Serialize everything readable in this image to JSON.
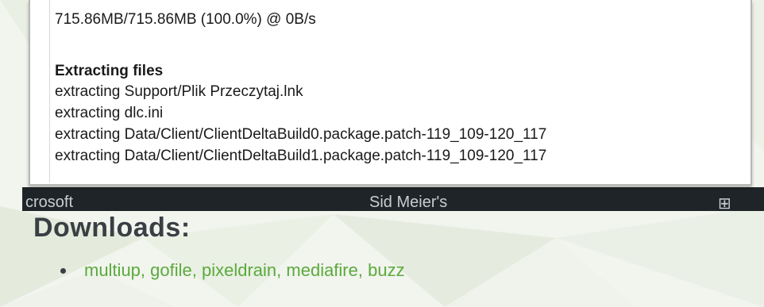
{
  "log": {
    "progress": "715.86MB/715.86MB (100.0%) @ 0B/s",
    "heading": "Extracting files",
    "lines": [
      "extracting Support/Plik Przeczytaj.lnk",
      "extracting dlc.ini",
      "extracting Data/Client/ClientDeltaBuild0.package.patch-119_109-120_117",
      "extracting Data/Client/ClientDeltaBuild1.package.patch-119_109-120_117"
    ]
  },
  "background_strip": {
    "left_text": "crosoft",
    "middle_text": "Sid Meier's",
    "right_text": "⊞"
  },
  "downloads": {
    "title": "Downloads:",
    "links": [
      {
        "label": "multiup"
      },
      {
        "label": "gofile"
      },
      {
        "label": "pixeldrain"
      },
      {
        "label": "mediafire"
      },
      {
        "label": "buzz"
      }
    ],
    "separator": ", "
  },
  "colors": {
    "link": "#5aaa3c",
    "heading": "#3a3f44",
    "background": "#f3f5ef"
  }
}
